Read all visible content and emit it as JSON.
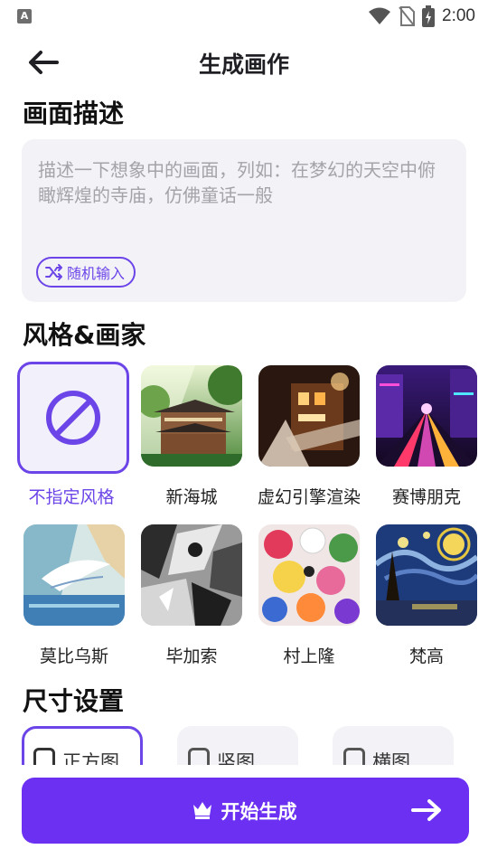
{
  "status_bar": {
    "time": "2:00",
    "app_badge": "A"
  },
  "header": {
    "title": "生成画作"
  },
  "description": {
    "section_title": "画面描述",
    "placeholder": "描述一下想象中的画面，列如：在梦幻的天空中俯 瞰辉煌的寺庙，仿佛童话一般",
    "value": "",
    "random_button_label": "随机输入"
  },
  "styles": {
    "section_title": "风格&画家",
    "items": [
      {
        "label": "不指定风格",
        "selected": true
      },
      {
        "label": "新海城",
        "selected": false
      },
      {
        "label": "虚幻引擎渲染",
        "selected": false
      },
      {
        "label": "赛博朋克",
        "selected": false
      },
      {
        "label": "莫比乌斯",
        "selected": false
      },
      {
        "label": "毕加索",
        "selected": false
      },
      {
        "label": "村上隆",
        "selected": false
      },
      {
        "label": "梵高",
        "selected": false
      }
    ]
  },
  "size": {
    "section_title": "尺寸设置",
    "options": [
      {
        "label": "正方图",
        "selected": true
      },
      {
        "label": "竖图",
        "selected": false
      },
      {
        "label": "横图",
        "selected": false
      }
    ]
  },
  "generate_button": {
    "label": "开始生成"
  },
  "colors": {
    "accent": "#6b30f2",
    "accent_outline": "#6c45e8",
    "input_bg": "#f3f3f7"
  }
}
